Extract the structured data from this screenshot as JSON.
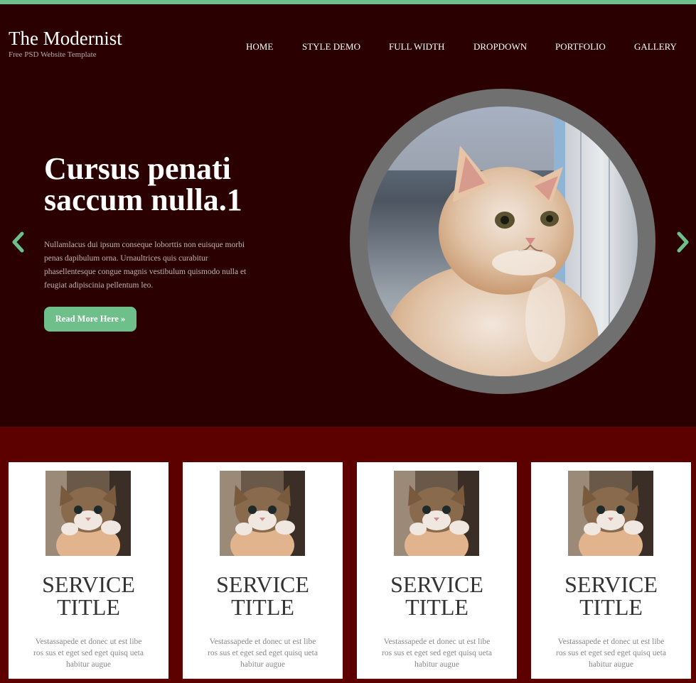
{
  "site": {
    "title": "The Modernist",
    "tagline": "Free PSD Website Template"
  },
  "nav": {
    "items": [
      "HOME",
      "STYLE DEMO",
      "FULL WIDTH",
      "DROPDOWN",
      "PORTFOLIO",
      "GALLERY"
    ]
  },
  "hero": {
    "title": "Cursus penati saccum nulla.1",
    "text": "Nullamlacus dui ipsum conseque loborttis non euisque morbi penas dapibulum orna. Urnaultrices quis curabitur phasellentesque congue magnis vestibulum quismodo nulla et feugiat adipiscinia pellentum leo.",
    "button_label": "Read More Here »",
    "prev_icon": "chevron-left-icon",
    "next_icon": "chevron-right-icon"
  },
  "services": [
    {
      "title": "SERVICE TITLE",
      "text": "Vestassapede et donec ut est libe ros sus et eget sed eget quisq ueta habitur augue"
    },
    {
      "title": "SERVICE TITLE",
      "text": "Vestassapede et donec ut est libe ros sus et eget sed eget quisq ueta habitur augue"
    },
    {
      "title": "SERVICE TITLE",
      "text": "Vestassapede et donec ut est libe ros sus et eget sed eget quisq ueta habitur augue"
    },
    {
      "title": "SERVICE TITLE",
      "text": "Vestassapede et donec ut est libe ros sus et eget sed eget quisq ueta habitur augue"
    }
  ],
  "colors": {
    "accent": "#6fbf8a",
    "header_bg": "#2a0000",
    "services_bg": "#5c0000",
    "ring": "#707070"
  }
}
